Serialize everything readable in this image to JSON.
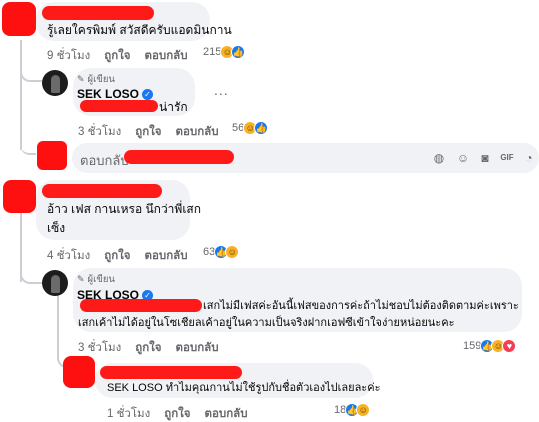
{
  "comments": [
    {
      "text": "รู้เลยใครพิมพ์ สวัสดีครับแอดมินกาน",
      "time": "9 ชั่วโมง",
      "like": "ถูกใจ",
      "reply": "ตอบกลับ",
      "reaction_count": "215"
    },
    {
      "author_badge": "ผู้เขียน",
      "name": "SEK LOSO",
      "text": "น่ารัก",
      "time": "3 ชั่วโมง",
      "like": "ถูกใจ",
      "reply": "ตอบกลับ",
      "reaction_count": "56",
      "more": "..."
    },
    {
      "text_line1": "อ้าว เฟส กานเหรอ นึกว่าพี่เสก",
      "text_line2": "เซ็ง",
      "time": "4 ชั่วโมง",
      "like": "ถูกใจ",
      "reply": "ตอบกลับ",
      "reaction_count": "63"
    },
    {
      "author_badge": "ผู้เขียน",
      "name": "SEK LOSO",
      "text_line1": "เสกไม่มีเฟสค่ะอันนี้เฟสของการค่ะถ้าไม่ชอบไม่ต้องติดตามค่ะเพราะ",
      "text_line2": "เสกเค้าไม่ได้อยู่ในโซเชียลเค้าอยู่ในความเป็นจริงฝากเอฟซีเข้าใจง่ายหน่อยนะคะ",
      "time": "3 ชั่วโมง",
      "like": "ถูกใจ",
      "reply": "ตอบกลับ",
      "reaction_count": "159"
    },
    {
      "text": "SEK LOSO ทำไมคุณกานไม่ใช้รูปกับชื่อตัวเองไปเลยละค่ะ",
      "time": "1 ชั่วโมง",
      "like": "ถูกใจ",
      "reply": "ตอบกลับ",
      "reaction_count": "18"
    }
  ],
  "reply_box": {
    "placeholder": "ตอบกลับ",
    "icons": [
      "avatar-sticker-icon",
      "emoji-icon",
      "camera-icon",
      "gif-icon",
      "sticker-icon"
    ]
  },
  "colors": {
    "bubble": "#f0f2f5",
    "meta_text": "#65676b",
    "redaction": "#ff1a1a",
    "like_blue": "#1877f2",
    "haha_yellow": "#f7b125"
  }
}
